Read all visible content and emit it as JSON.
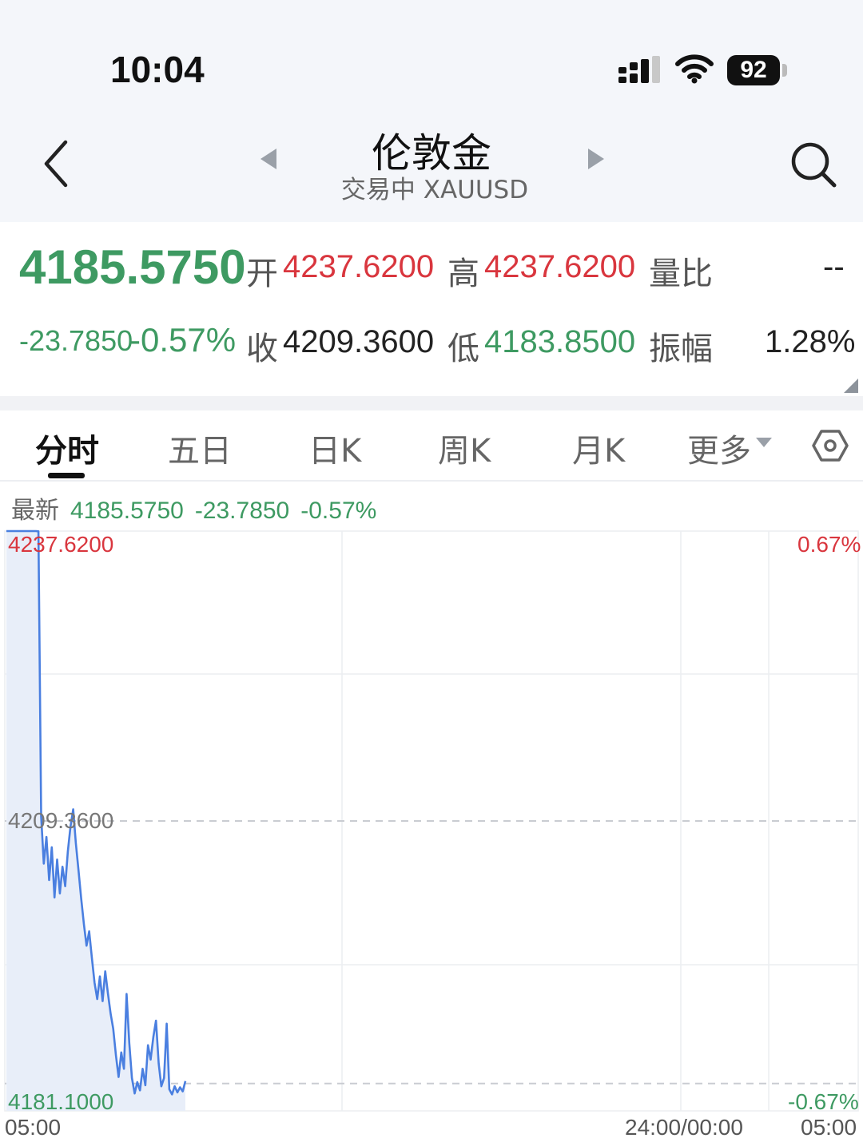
{
  "status_bar": {
    "time": "10:04",
    "battery": "92"
  },
  "header": {
    "title": "伦敦金",
    "subtitle": "交易中 XAUUSD"
  },
  "quote": {
    "price": "4185.5750",
    "change": "-23.7850",
    "change_pct": "-0.57%",
    "open_label": "开",
    "open": "4237.6200",
    "high_label": "高",
    "high": "4237.6200",
    "volume_ratio_label": "量比",
    "volume_ratio": "--",
    "close_label": "收",
    "close": "4209.3600",
    "low_label": "低",
    "low": "4183.8500",
    "amplitude_label": "振幅",
    "amplitude": "1.28%"
  },
  "tabs": [
    {
      "label": "分时",
      "active": true
    },
    {
      "label": "五日"
    },
    {
      "label": "日K"
    },
    {
      "label": "周K"
    },
    {
      "label": "月K"
    },
    {
      "label": "更多"
    }
  ],
  "latest": {
    "label": "最新",
    "price": "4185.5750",
    "change": "-23.7850",
    "change_pct": "-0.57%"
  },
  "colors": {
    "up": "#d9363e",
    "down": "#3e9a62",
    "line": "#4a7fe0",
    "fill": "#e8eef9"
  },
  "chart_data": {
    "type": "line",
    "title": "",
    "y_axis_labels": {
      "top": "4237.6200",
      "middle": "4209.3600",
      "bottom": "4181.1000"
    },
    "right_axis_labels": {
      "top": "0.67%",
      "bottom": "-0.67%"
    },
    "x_tick_labels": [
      "05:00",
      "24:00/00:00",
      "05:00"
    ],
    "ylim": [
      4181.1,
      4237.62
    ],
    "reference_price": 4209.36,
    "series": [
      {
        "values": [
          4237.62,
          4237.62,
          4237.62,
          4237.62,
          4237.62,
          4237.62,
          4237.62,
          4237.62,
          4237.62,
          4237.62,
          4237.62,
          4237.62,
          4237.6,
          4209.8,
          4205.2,
          4207.8,
          4203.6,
          4206.8,
          4201.9,
          4205.6,
          4202.3,
          4204.9,
          4203.0,
          4206.4,
          4208.8,
          4210.5,
          4207.2,
          4204.5,
          4201.8,
          4199.3,
          4197.2,
          4198.6,
          4196.0,
          4193.6,
          4192.0,
          4194.2,
          4191.8,
          4194.7,
          4192.6,
          4190.6,
          4189.1,
          4186.5,
          4184.4,
          4186.8,
          4185.2,
          4192.5,
          4187.7,
          4184.3,
          4182.8,
          4183.9,
          4183.1,
          4185.2,
          4183.6,
          4187.5,
          4186.1,
          4188.3,
          4189.9,
          4185.7,
          4183.5,
          4184.3,
          4189.6,
          4183.2,
          4182.7,
          4183.5,
          4182.9,
          4183.4,
          4183.0,
          4184.0
        ]
      }
    ]
  }
}
